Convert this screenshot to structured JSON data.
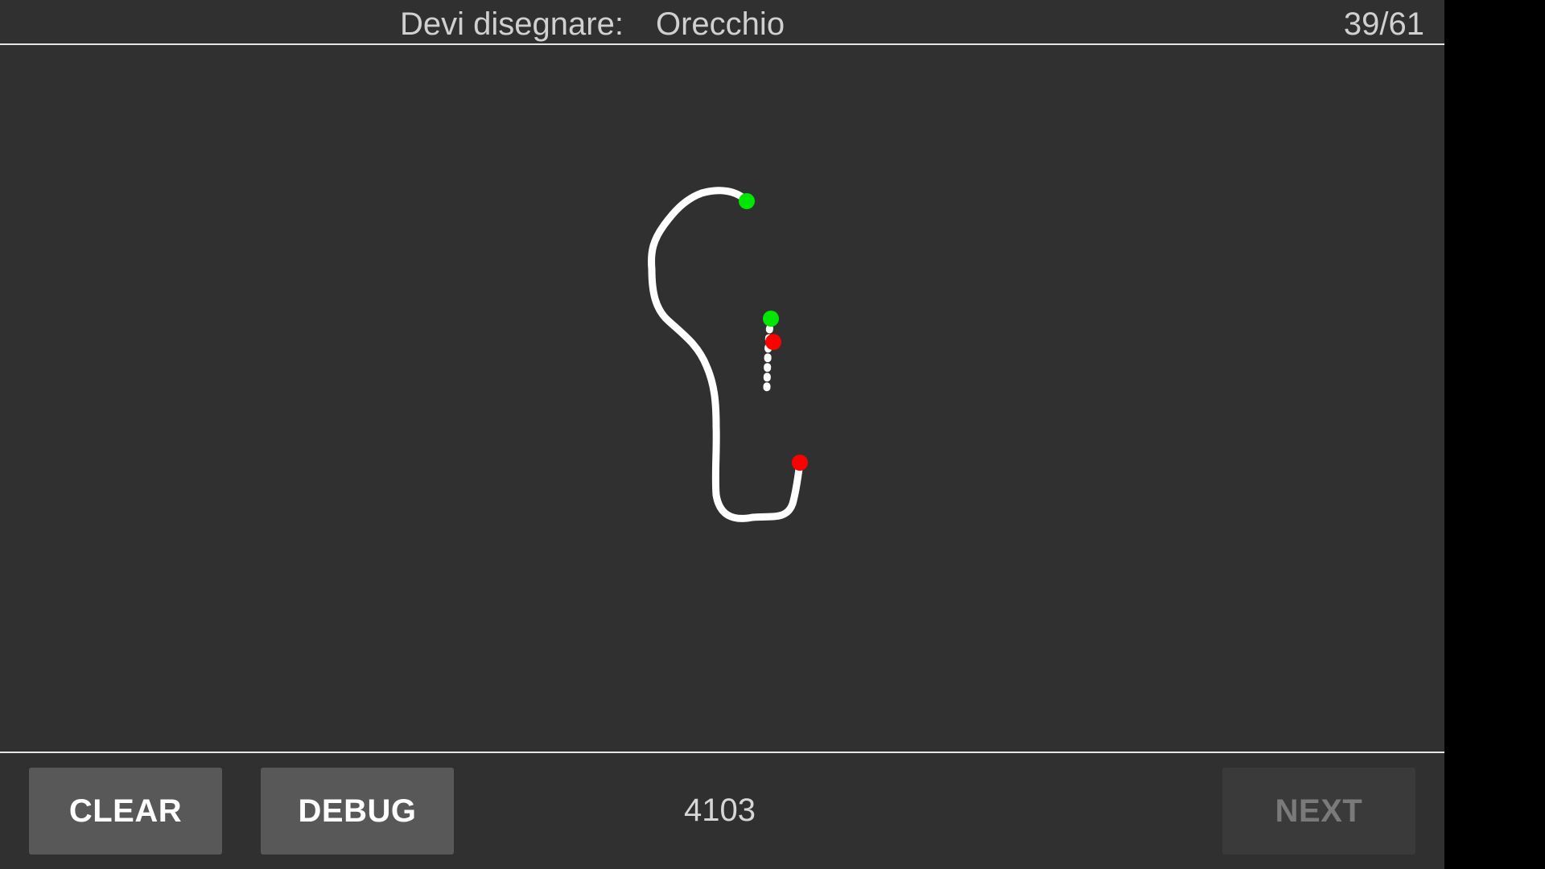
{
  "header": {
    "prompt_label": "Devi disegnare:",
    "prompt_word": "Orecchio",
    "progress": "39/61"
  },
  "footer": {
    "clear_label": "CLEAR",
    "debug_label": "DEBUG",
    "counter": "4103",
    "next_label": "NEXT",
    "next_enabled": false
  },
  "colors": {
    "background": "#303030",
    "stroke": "#ffffff",
    "stroke_start": "#00e600",
    "stroke_end": "#ff0000",
    "divider": "#e6e6e6"
  },
  "drawing": {
    "strokes": 2
  }
}
